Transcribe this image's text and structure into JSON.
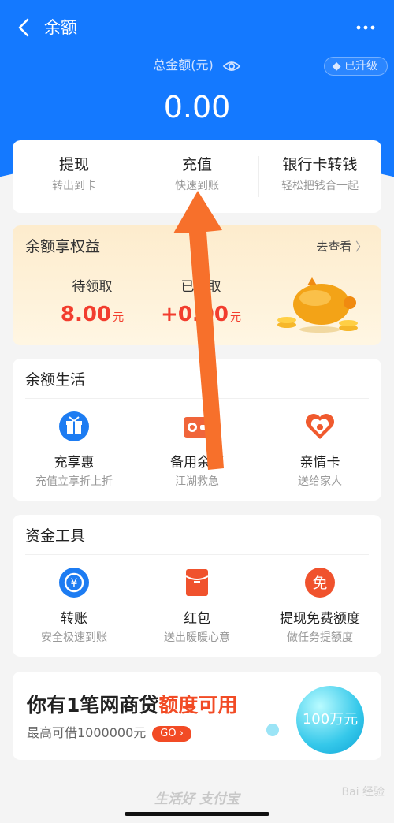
{
  "header": {
    "title": "余额",
    "total_label": "总金额(元)",
    "upgrade_label": "已升级",
    "amount": "0.00"
  },
  "actions": [
    {
      "label": "提现",
      "sub": "转出到卡"
    },
    {
      "label": "充值",
      "sub": "快速到账"
    },
    {
      "label": "银行卡转钱",
      "sub": "轻松把钱合一起"
    }
  ],
  "rights": {
    "title": "余额享权益",
    "link": "去查看",
    "pending_label": "待领取",
    "pending_value": "8.00",
    "pending_unit": "元",
    "received_label": "已领取",
    "received_value": "+0.00",
    "received_unit": "元"
  },
  "life": {
    "title": "余额生活",
    "items": [
      {
        "label": "充享惠",
        "sub": "充值立享折上折",
        "icon": "gift-icon"
      },
      {
        "label": "备用余额",
        "sub": "江湖救急",
        "icon": "wallet-icon"
      },
      {
        "label": "亲情卡",
        "sub": "送给家人",
        "icon": "heart-icon"
      }
    ]
  },
  "tools": {
    "title": "资金工具",
    "items": [
      {
        "label": "转账",
        "sub": "安全极速到账",
        "icon": "transfer-icon"
      },
      {
        "label": "红包",
        "sub": "送出暖暖心意",
        "icon": "red-envelope-icon"
      },
      {
        "label": "提现免费额度",
        "sub": "做任务提额度",
        "icon": "free-icon",
        "glyph": "免"
      }
    ]
  },
  "loan": {
    "title_a": "你有1笔网商贷",
    "title_b": "额度可用",
    "sub": "最高可借1000000元",
    "go": "GO",
    "bubble": "100万元"
  },
  "footer": {
    "slogan": "生活好 支付宝",
    "watermark": "Bai 经验"
  },
  "colors": {
    "brand": "#1479ff",
    "accent": "#f24b25",
    "orange": "#f7702b"
  }
}
